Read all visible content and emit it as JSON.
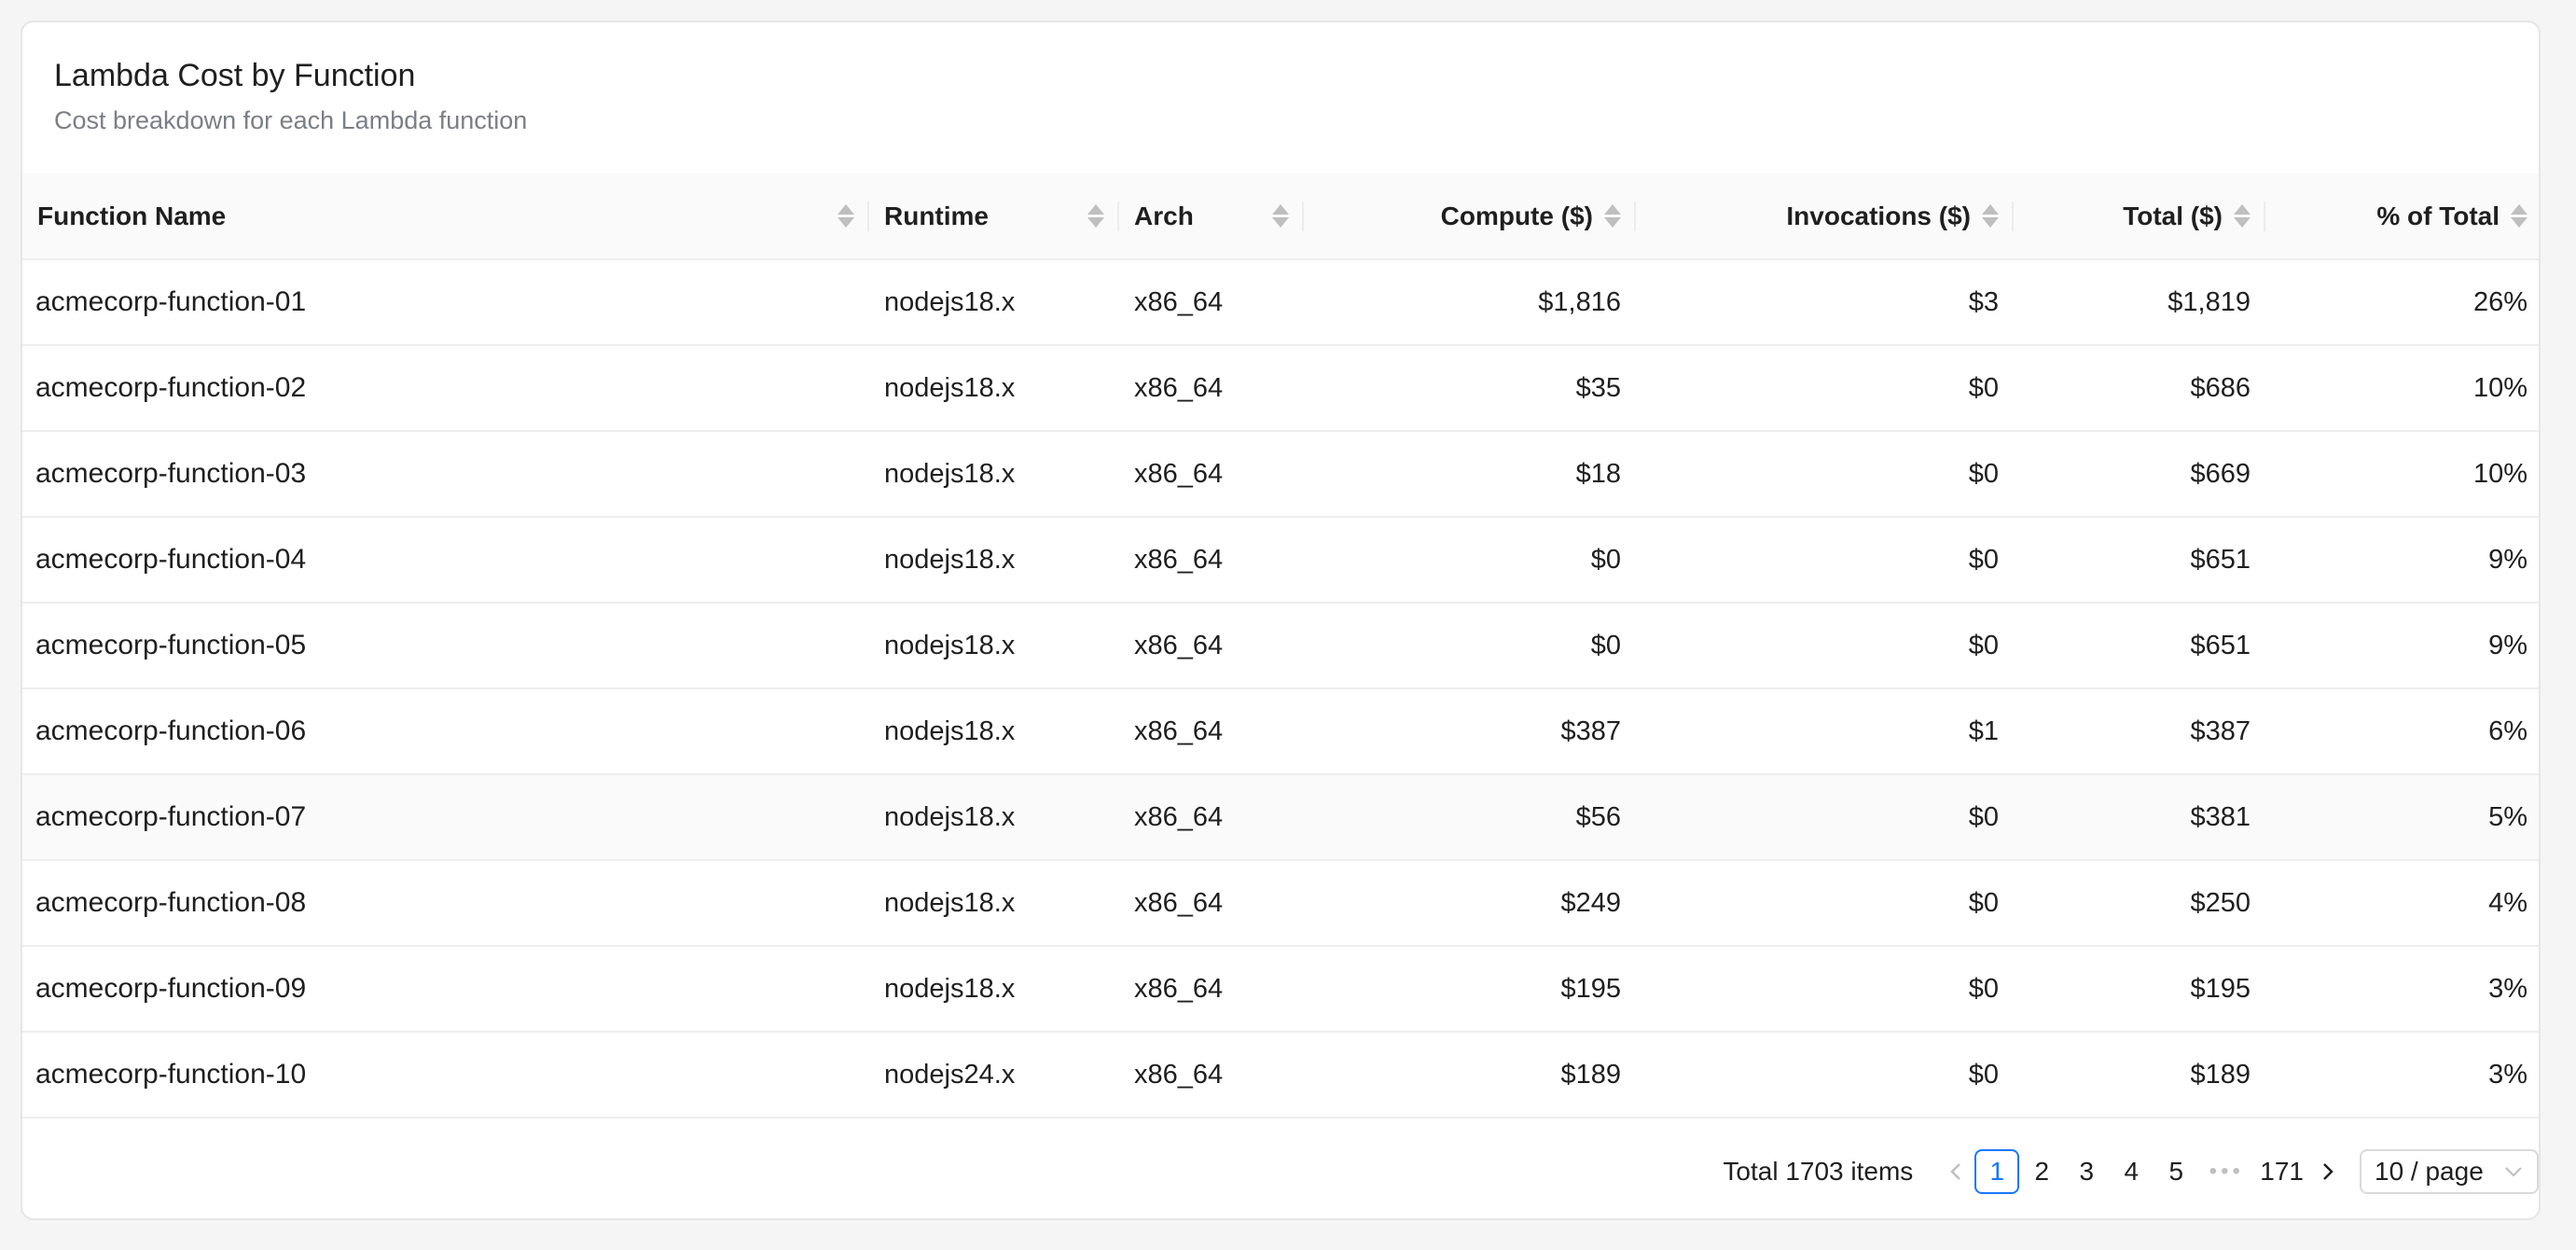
{
  "card": {
    "title": "Lambda Cost by Function",
    "subtitle": "Cost breakdown for each Lambda function"
  },
  "table": {
    "columns": [
      {
        "label": "Function Name",
        "align": "left"
      },
      {
        "label": "Runtime",
        "align": "left"
      },
      {
        "label": "Arch",
        "align": "left"
      },
      {
        "label": "Compute ($)",
        "align": "right"
      },
      {
        "label": "Invocations ($)",
        "align": "right"
      },
      {
        "label": "Total ($)",
        "align": "right"
      },
      {
        "label": "% of Total",
        "align": "right"
      }
    ],
    "rows": [
      {
        "name": "acmecorp-function-01",
        "runtime": "nodejs18.x",
        "arch": "x86_64",
        "compute": "$1,816",
        "invocations": "$3",
        "total": "$1,819",
        "pct": "26%"
      },
      {
        "name": "acmecorp-function-02",
        "runtime": "nodejs18.x",
        "arch": "x86_64",
        "compute": "$35",
        "invocations": "$0",
        "total": "$686",
        "pct": "10%"
      },
      {
        "name": "acmecorp-function-03",
        "runtime": "nodejs18.x",
        "arch": "x86_64",
        "compute": "$18",
        "invocations": "$0",
        "total": "$669",
        "pct": "10%"
      },
      {
        "name": "acmecorp-function-04",
        "runtime": "nodejs18.x",
        "arch": "x86_64",
        "compute": "$0",
        "invocations": "$0",
        "total": "$651",
        "pct": "9%"
      },
      {
        "name": "acmecorp-function-05",
        "runtime": "nodejs18.x",
        "arch": "x86_64",
        "compute": "$0",
        "invocations": "$0",
        "total": "$651",
        "pct": "9%"
      },
      {
        "name": "acmecorp-function-06",
        "runtime": "nodejs18.x",
        "arch": "x86_64",
        "compute": "$387",
        "invocations": "$1",
        "total": "$387",
        "pct": "6%"
      },
      {
        "name": "acmecorp-function-07",
        "runtime": "nodejs18.x",
        "arch": "x86_64",
        "compute": "$56",
        "invocations": "$0",
        "total": "$381",
        "pct": "5%"
      },
      {
        "name": "acmecorp-function-08",
        "runtime": "nodejs18.x",
        "arch": "x86_64",
        "compute": "$249",
        "invocations": "$0",
        "total": "$250",
        "pct": "4%"
      },
      {
        "name": "acmecorp-function-09",
        "runtime": "nodejs18.x",
        "arch": "x86_64",
        "compute": "$195",
        "invocations": "$0",
        "total": "$195",
        "pct": "3%"
      },
      {
        "name": "acmecorp-function-10",
        "runtime": "nodejs24.x",
        "arch": "x86_64",
        "compute": "$189",
        "invocations": "$0",
        "total": "$189",
        "pct": "3%"
      }
    ]
  },
  "pagination": {
    "total_text": "Total 1703 items",
    "pages": [
      "1",
      "2",
      "3",
      "4",
      "5"
    ],
    "dots": "•••",
    "last_page": "171",
    "current_page": "1",
    "page_size": "10 / page",
    "icons": {
      "prev": "chevron-left-icon",
      "next": "chevron-right-icon",
      "select": "chevron-down-icon"
    }
  },
  "colors": {
    "accent": "#1677ff",
    "header_bg": "#fafafa",
    "border": "#eeeeee",
    "muted_text": "#7a7f87"
  }
}
